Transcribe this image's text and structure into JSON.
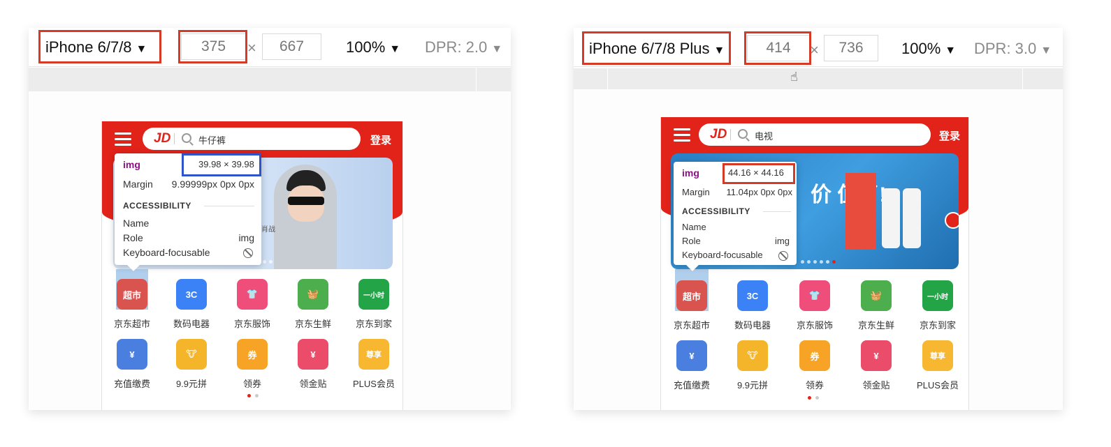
{
  "left": {
    "device_label": "iPhone 6/7/8",
    "width_value": "375",
    "height_value": "667",
    "times": "×",
    "zoom": "100%",
    "dpr": "DPR: 2.0",
    "search_text": "牛仔裤",
    "login": "登录",
    "logo": "JD",
    "tooltip": {
      "tag": "img",
      "size": "39.98 × 39.98",
      "margin_label": "Margin",
      "margin_value": "9.99999px 0px 0px",
      "section": "ACCESSIBILITY",
      "name_label": "Name",
      "role_label": "Role",
      "role_value": "img",
      "focus_label": "Keyboard-focusable"
    },
    "banner_caption": "肖战"
  },
  "right": {
    "device_label": "iPhone 6/7/8 Plus",
    "width_value": "414",
    "height_value": "736",
    "times": "×",
    "zoom": "100%",
    "dpr": "DPR: 3.0",
    "search_text": "电视",
    "login": "登录",
    "logo": "JD",
    "tooltip": {
      "tag": "img",
      "size": "44.16 × 44.16",
      "margin_label": "Margin",
      "margin_value": "11.04px 0px 0px",
      "section": "ACCESSIBILITY",
      "name_label": "Name",
      "role_label": "Role",
      "role_value": "img",
      "focus_label": "Keyboard-focusable"
    },
    "banner_text": "价 值了!"
  },
  "nav_items": [
    {
      "label": "京东超市",
      "icon": "supermarket-icon",
      "color": "#d9534f",
      "glyph": "超市"
    },
    {
      "label": "数码电器",
      "icon": "3c-digital-icon",
      "color": "#3b82f6",
      "glyph": "3C"
    },
    {
      "label": "京东服饰",
      "icon": "tshirt-icon",
      "color": "#ef4e7b",
      "glyph": "👕"
    },
    {
      "label": "京东生鲜",
      "icon": "fresh-basket-icon",
      "color": "#4cae4c",
      "glyph": "🧺"
    },
    {
      "label": "京东到家",
      "icon": "one-hour-delivery-icon",
      "color": "#22a447",
      "glyph": "一小时"
    },
    {
      "label": "充值缴费",
      "icon": "recharge-icon",
      "color": "#4a7fe0",
      "glyph": "¥"
    },
    {
      "label": "9.9元拼",
      "icon": "cow-group-buy-icon",
      "color": "#f5b52a",
      "glyph": "🐮"
    },
    {
      "label": "领券",
      "icon": "coupon-icon",
      "color": "#f7a325",
      "glyph": "券"
    },
    {
      "label": "领金贴",
      "icon": "red-packet-icon",
      "color": "#ea4c6a",
      "glyph": "¥"
    },
    {
      "label": "PLUS会员",
      "icon": "plus-member-crown-icon",
      "color": "#f7b731",
      "glyph": "尊享"
    }
  ]
}
